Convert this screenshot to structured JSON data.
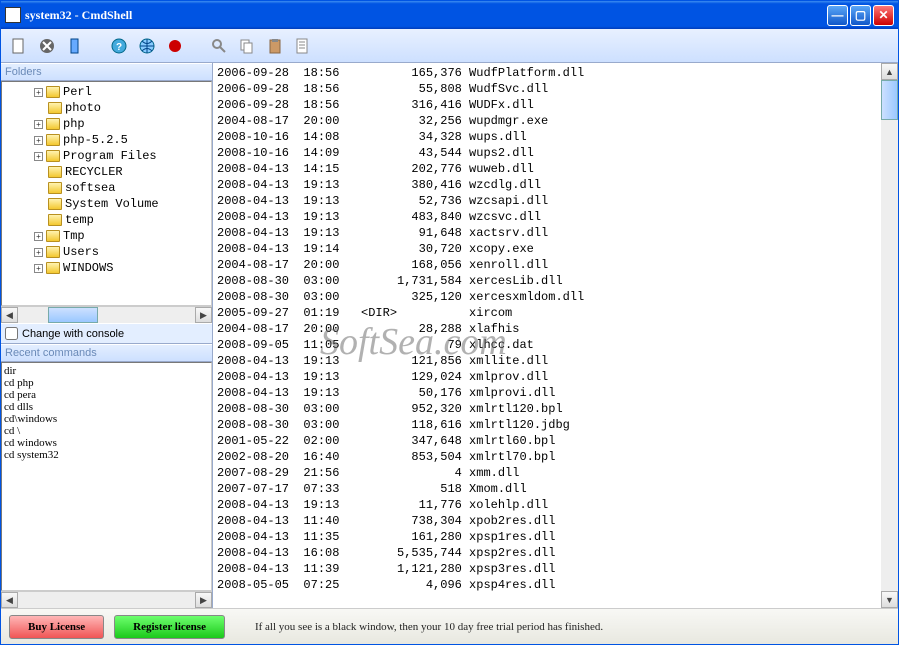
{
  "window": {
    "title": "system32 - CmdShell"
  },
  "folders": {
    "title": "Folders",
    "items": [
      {
        "exp": true,
        "label": "Perl"
      },
      {
        "exp": false,
        "label": "photo"
      },
      {
        "exp": true,
        "label": "php"
      },
      {
        "exp": true,
        "label": "php-5.2.5"
      },
      {
        "exp": true,
        "label": "Program Files"
      },
      {
        "exp": false,
        "label": "RECYCLER"
      },
      {
        "exp": false,
        "label": "softsea"
      },
      {
        "exp": false,
        "label": "System Volume"
      },
      {
        "exp": false,
        "label": "temp"
      },
      {
        "exp": true,
        "label": "Tmp"
      },
      {
        "exp": true,
        "label": "Users"
      },
      {
        "exp": true,
        "label": "WINDOWS"
      }
    ]
  },
  "checkbox": {
    "label": "Change with console",
    "checked": false
  },
  "recent": {
    "title": "Recent commands",
    "items": [
      "dir",
      "cd php",
      "cd pera",
      "cd dlls",
      "cd\\windows",
      "cd \\",
      "cd windows",
      "cd system32"
    ]
  },
  "console": {
    "rows": [
      {
        "d": "2006-09-28",
        "t": "18:56",
        "s": "165,376",
        "n": "WudfPlatform.dll"
      },
      {
        "d": "2006-09-28",
        "t": "18:56",
        "s": "55,808",
        "n": "WudfSvc.dll"
      },
      {
        "d": "2006-09-28",
        "t": "18:56",
        "s": "316,416",
        "n": "WUDFx.dll"
      },
      {
        "d": "2004-08-17",
        "t": "20:00",
        "s": "32,256",
        "n": "wupdmgr.exe"
      },
      {
        "d": "2008-10-16",
        "t": "14:08",
        "s": "34,328",
        "n": "wups.dll"
      },
      {
        "d": "2008-10-16",
        "t": "14:09",
        "s": "43,544",
        "n": "wups2.dll"
      },
      {
        "d": "2008-04-13",
        "t": "14:15",
        "s": "202,776",
        "n": "wuweb.dll"
      },
      {
        "d": "2008-04-13",
        "t": "19:13",
        "s": "380,416",
        "n": "wzcdlg.dll"
      },
      {
        "d": "2008-04-13",
        "t": "19:13",
        "s": "52,736",
        "n": "wzcsapi.dll"
      },
      {
        "d": "2008-04-13",
        "t": "19:13",
        "s": "483,840",
        "n": "wzcsvc.dll"
      },
      {
        "d": "2008-04-13",
        "t": "19:13",
        "s": "91,648",
        "n": "xactsrv.dll"
      },
      {
        "d": "2008-04-13",
        "t": "19:14",
        "s": "30,720",
        "n": "xcopy.exe"
      },
      {
        "d": "2004-08-17",
        "t": "20:00",
        "s": "168,056",
        "n": "xenroll.dll"
      },
      {
        "d": "2008-08-30",
        "t": "03:00",
        "s": "1,731,584",
        "n": "xercesLib.dll"
      },
      {
        "d": "2008-08-30",
        "t": "03:00",
        "s": "325,120",
        "n": "xercesxmldom.dll"
      },
      {
        "d": "2005-09-27",
        "t": "01:19",
        "s": "<DIR>",
        "n": "xircom",
        "dir": true
      },
      {
        "d": "2004-08-17",
        "t": "20:00",
        "s": "28,288",
        "n": "xlafhis"
      },
      {
        "d": "2008-09-05",
        "t": "11:05",
        "s": "79",
        "n": "xlhcc.dat"
      },
      {
        "d": "2008-04-13",
        "t": "19:13",
        "s": "121,856",
        "n": "xmllite.dll"
      },
      {
        "d": "2008-04-13",
        "t": "19:13",
        "s": "129,024",
        "n": "xmlprov.dll"
      },
      {
        "d": "2008-04-13",
        "t": "19:13",
        "s": "50,176",
        "n": "xmlprovi.dll"
      },
      {
        "d": "2008-08-30",
        "t": "03:00",
        "s": "952,320",
        "n": "xmlrtl120.bpl"
      },
      {
        "d": "2008-08-30",
        "t": "03:00",
        "s": "118,616",
        "n": "xmlrtl120.jdbg"
      },
      {
        "d": "2001-05-22",
        "t": "02:00",
        "s": "347,648",
        "n": "xmlrtl60.bpl"
      },
      {
        "d": "2002-08-20",
        "t": "16:40",
        "s": "853,504",
        "n": "xmlrtl70.bpl"
      },
      {
        "d": "2007-08-29",
        "t": "21:56",
        "s": "4",
        "n": "xmm.dll"
      },
      {
        "d": "2007-07-17",
        "t": "07:33",
        "s": "518",
        "n": "Xmom.dll"
      },
      {
        "d": "2008-04-13",
        "t": "19:13",
        "s": "11,776",
        "n": "xolehlp.dll"
      },
      {
        "d": "2008-04-13",
        "t": "11:40",
        "s": "738,304",
        "n": "xpob2res.dll"
      },
      {
        "d": "2008-04-13",
        "t": "11:35",
        "s": "161,280",
        "n": "xpsp1res.dll"
      },
      {
        "d": "2008-04-13",
        "t": "16:08",
        "s": "5,535,744",
        "n": "xpsp2res.dll"
      },
      {
        "d": "2008-04-13",
        "t": "11:39",
        "s": "1,121,280",
        "n": "xpsp3res.dll"
      },
      {
        "d": "2008-05-05",
        "t": "07:25",
        "s": "4,096",
        "n": "xpsp4res.dll"
      }
    ]
  },
  "status": {
    "buy": "Buy License",
    "reg": "Register license",
    "text": "If all you see is a black window, then your 10 day free trial period has finished."
  },
  "watermark": "SoftSea.com"
}
